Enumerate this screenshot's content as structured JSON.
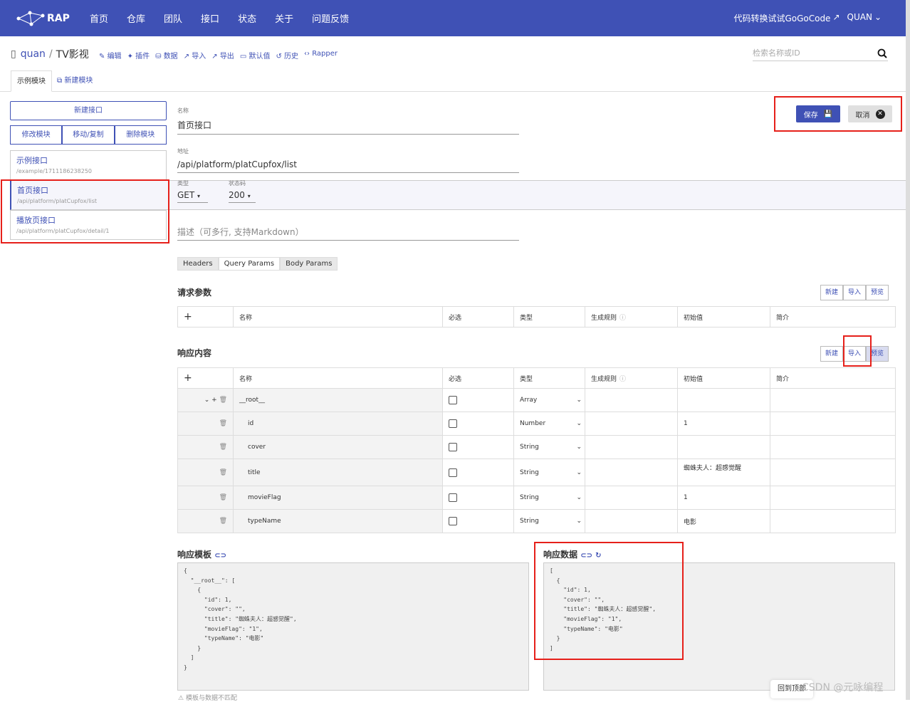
{
  "nav": {
    "brand": "RAP",
    "menu": [
      "首页",
      "仓库",
      "团队",
      "接口",
      "状态",
      "关于",
      "问题反馈"
    ],
    "right_link": "代码转换试试GoGoCode",
    "user": "QUAN"
  },
  "crumb": {
    "owner": "quan",
    "sep": "/",
    "repo": "TV影视"
  },
  "toolbar": [
    "编辑",
    "插件",
    "数据",
    "导入",
    "导出",
    "默认值",
    "历史",
    "Rapper"
  ],
  "search": {
    "placeholder": "检索名称或ID"
  },
  "tabs": {
    "active": "示例模块",
    "add": "新建模块"
  },
  "side": {
    "new_iface": "新建接口",
    "edit_module": "修改模块",
    "move_copy": "移动/复制",
    "delete_module": "删除模块",
    "interfaces": [
      {
        "name": "示例接口",
        "url": "/example/1711186238250"
      },
      {
        "name": "首页接口",
        "url": "/api/platform/platCupfox/list"
      },
      {
        "name": "播放页接口",
        "url": "/api/platform/platCupfox/detail/1"
      }
    ]
  },
  "form": {
    "name_label": "名称",
    "name": "首页接口",
    "url_label": "地址",
    "url": "/api/platform/platCupfox/list",
    "type_label": "类型",
    "type": "GET",
    "status_label": "状态码",
    "status": "200",
    "desc_placeholder": "描述（可多行, 支持Markdown）"
  },
  "actions": {
    "save": "保存",
    "cancel": "取消"
  },
  "param_tabs": [
    "Headers",
    "Query Params",
    "Body Params"
  ],
  "request": {
    "title": "请求参数",
    "btns": [
      "新建",
      "导入",
      "预览"
    ]
  },
  "response": {
    "title": "响应内容",
    "btns": [
      "新建",
      "导入",
      "预览"
    ]
  },
  "cols": [
    "名称",
    "必选",
    "类型",
    "生成规则",
    "初始值",
    "简介"
  ],
  "rows": [
    {
      "name": "__root__",
      "type": "Array",
      "init": ""
    },
    {
      "name": "id",
      "type": "Number",
      "init": "1"
    },
    {
      "name": "cover",
      "type": "String",
      "init": ""
    },
    {
      "name": "title",
      "type": "String",
      "init": "蜘蛛夫人：超感觉醒"
    },
    {
      "name": "movieFlag",
      "type": "String",
      "init": "1"
    },
    {
      "name": "typeName",
      "type": "String",
      "init": "电影"
    }
  ],
  "template": {
    "title": "响应模板",
    "code": "{\n  \"__root__\": [\n    {\n      \"id\": 1,\n      \"cover\": \"\",\n      \"title\": \"蜘蛛夫人：超感觉醒\",\n      \"movieFlag\": \"1\",\n      \"typeName\": \"电影\"\n    }\n  ]\n}"
  },
  "data": {
    "title": "响应数据",
    "code": "[\n  {\n    \"id\": 1,\n    \"cover\": \"\",\n    \"title\": \"蜘蛛夫人：超感觉醒\",\n    \"movieFlag\": \"1\",\n    \"typeName\": \"电影\"\n  }\n]"
  },
  "footer": {
    "mismatch": "模板与数据不匹配",
    "back_top": "回到顶部",
    "watermark": "CSDN @元咏编程"
  }
}
